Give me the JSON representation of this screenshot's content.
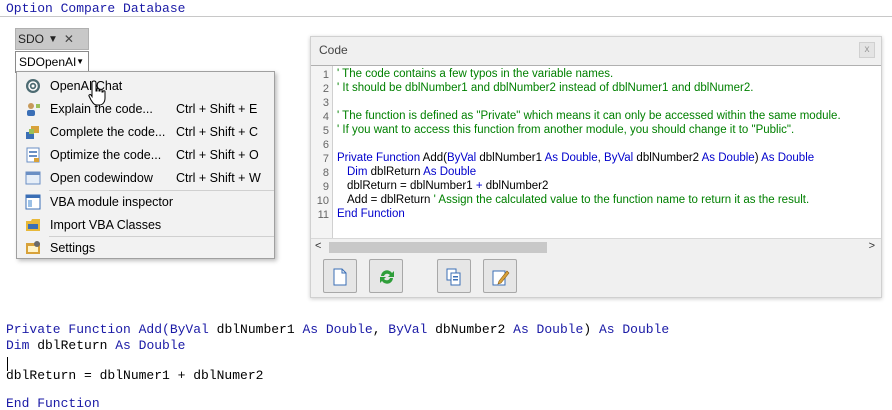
{
  "editor": {
    "option_line": "Option Compare Database",
    "lines": {
      "l1_kw1": "Private Function Add(ByVal",
      "l1_t1": " dblNumber1 ",
      "l1_kw2": "As Double",
      "l1_t2": ", ",
      "l1_kw3": "ByVal",
      "l1_t3": " dbNumber2 ",
      "l1_kw4": "As Double",
      "l1_t4": ") ",
      "l1_kw5": "As Double",
      "l2_kw1": "Dim",
      "l2_t1": " dblReturn ",
      "l2_kw2": "As Double",
      "l3": "dblReturn = dblNumer1 + dblNumer2",
      "l4": "End Function"
    }
  },
  "toolbar": {
    "label": "SDO",
    "arrow": "▼",
    "close": "✕",
    "button_label": "SDOpenAI",
    "button_arrow": "▼"
  },
  "menu": {
    "items": [
      {
        "label": "OpenAI Chat",
        "shortcut": "",
        "icon": "chat-icon"
      },
      {
        "label": "Explain the code...",
        "shortcut": "Ctrl + Shift + E",
        "icon": "explain-icon"
      },
      {
        "label": "Complete the code...",
        "shortcut": "Ctrl + Shift + C",
        "icon": "complete-icon"
      },
      {
        "label": "Optimize the code...",
        "shortcut": "Ctrl + Shift + O",
        "icon": "optimize-icon"
      },
      {
        "label": "Open codewindow",
        "shortcut": "Ctrl + Shift + W",
        "icon": "codewindow-icon"
      },
      {
        "label": "VBA module inspector",
        "shortcut": "",
        "icon": "inspector-icon"
      },
      {
        "label": "Import VBA Classes",
        "shortcut": "",
        "icon": "import-icon"
      },
      {
        "label": "Settings",
        "shortcut": "",
        "icon": "settings-icon"
      }
    ]
  },
  "code_window": {
    "title": "Code",
    "close": "x",
    "line_numbers": [
      "1",
      "2",
      "3",
      "4",
      "5",
      "6",
      "7",
      "8",
      "9",
      "10",
      "11"
    ],
    "lines": {
      "c1": "' The code contains a few typos in the variable names.",
      "c2": "' It should be dblNumber1 and dblNumber2 instead of dblNumer1 and dblNumer2.",
      "c4": "' The function is defined as \"Private\" which means it can only be accessed within the same module.",
      "c5": "' If you want to access this function from another module, you should change it to \"Public\".",
      "c7a": "Private Function",
      "c7b": " Add(",
      "c7c": "ByVal",
      "c7d": " dblNumber1 ",
      "c7e": "As Double",
      "c7f": ", ",
      "c7g": "ByVal",
      "c7h": " dblNumber2 ",
      "c7i": "As Double",
      "c7j": ") ",
      "c7k": "As Double",
      "c8a": "Dim",
      "c8b": " dblReturn ",
      "c8c": "As Double",
      "c9a": "dblReturn = dblNumber1 ",
      "c9b": "+",
      "c9c": " dblNumber2",
      "c10a": "Add = dblReturn ",
      "c10b": "' Assign the calculated value to the function name to return it as the result.",
      "c11": "End Function"
    },
    "scroll_left": "<",
    "scroll_right": ">"
  }
}
